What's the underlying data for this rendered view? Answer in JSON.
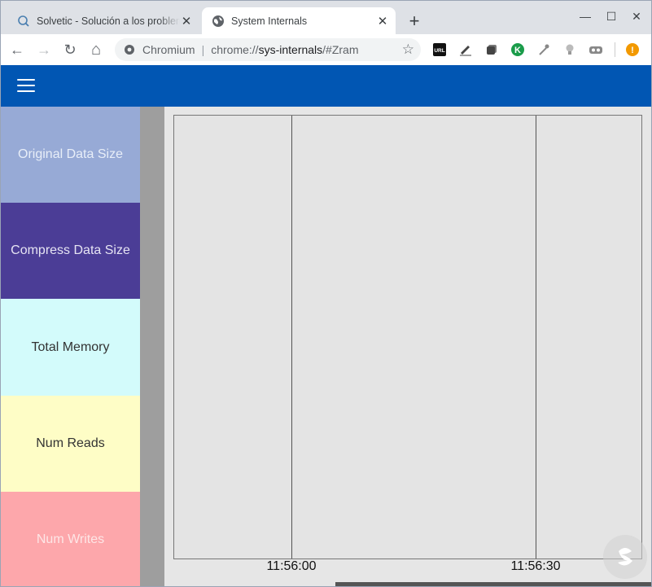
{
  "browser": {
    "tabs": [
      {
        "title": "Solvetic - Solución a los problemas",
        "active": false,
        "icon": "solvetic-search-icon"
      },
      {
        "title": "System Internals",
        "active": true,
        "icon": "globe-icon"
      }
    ],
    "new_tab_glyph": "+",
    "window_controls": {
      "minimize": "—",
      "maximize": "☐",
      "close": "✕"
    },
    "address": {
      "site_label": "Chromium",
      "url_prefix": "chrome://",
      "url_host": "sys-internals",
      "url_path": "/#Zram"
    },
    "nav_glyphs": {
      "back": "←",
      "forward": "→",
      "reload": "↻",
      "home": "⌂",
      "star": "☆"
    },
    "extensions": [
      "url-extension-icon",
      "pen-extension-icon",
      "tabs-extension-icon",
      "kaspersky-extension-icon",
      "eyedropper-extension-icon",
      "bulb-extension-icon",
      "vr-extension-icon"
    ],
    "extension_url_label": "URL",
    "extension_k_label": "K",
    "alert_glyph": "!"
  },
  "colors": {
    "appbar": "#0156b3",
    "original": "#97aad6",
    "compress": "#4b3d96",
    "total_memory": "#d3fbfb",
    "num_reads": "#fefdc6",
    "num_writes": "#fda7ab"
  },
  "legend": [
    {
      "label": "Original Data Size",
      "bg": "#97aad6",
      "fg": "#e8eef8"
    },
    {
      "label": "Compress Data Size",
      "bg": "#4b3d96",
      "fg": "#e6e4f3"
    },
    {
      "label": "Total Memory",
      "bg": "#d3fbfb",
      "fg": "#333333"
    },
    {
      "label": "Num Reads",
      "bg": "#fefdc6",
      "fg": "#333333"
    },
    {
      "label": "Num Writes",
      "bg": "#fda7ab",
      "fg": "#fde6e6"
    }
  ],
  "chart_data": {
    "type": "line",
    "x_ticks": [
      "11:56:00",
      "11:56:30"
    ],
    "series": []
  }
}
